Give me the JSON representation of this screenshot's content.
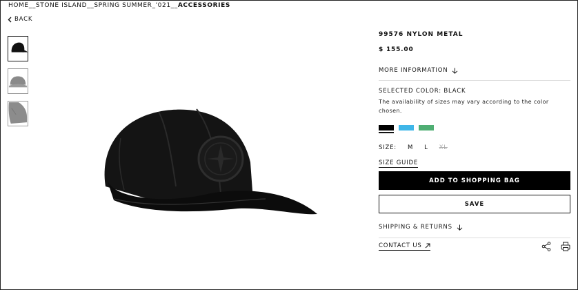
{
  "breadcrumb": {
    "home": "HOME",
    "brand": "STONE ISLAND",
    "season": "SPRING SUMMER_'021",
    "current": "ACCESSORIES",
    "separator": "__"
  },
  "back_label": "BACK",
  "product": {
    "title": "99576 NYLON METAL",
    "price": "$ 155.00",
    "more_info": "MORE INFORMATION",
    "selected_color": "SELECTED COLOR: BLACK",
    "availability": "The availability of sizes may vary according to the color chosen.",
    "swatches": [
      {
        "name": "black",
        "color": "#000000",
        "selected": true
      },
      {
        "name": "light-blue",
        "color": "#3fb6e8",
        "selected": false
      },
      {
        "name": "green",
        "color": "#4fae73",
        "selected": false
      }
    ],
    "size_label": "SIZE:",
    "sizes": [
      {
        "label": "M",
        "available": true
      },
      {
        "label": "L",
        "available": true
      },
      {
        "label": "XL",
        "available": false
      }
    ],
    "size_guide": "SIZE GUIDE",
    "add_to_bag": "ADD TO SHOPPING BAG",
    "save": "SAVE",
    "shipping": "SHIPPING & RETURNS",
    "contact": "CONTACT US"
  },
  "icons": {
    "back": "chevron-left-icon",
    "more_info": "arrow-down-icon",
    "shipping": "arrow-down-icon",
    "contact": "arrow-up-right-icon",
    "share": "share-icon",
    "print": "printer-icon"
  },
  "thumbnails": [
    {
      "name": "cap-black-side",
      "active": true
    },
    {
      "name": "cap-grey-front",
      "active": false
    },
    {
      "name": "cap-grey-back",
      "active": false
    }
  ]
}
